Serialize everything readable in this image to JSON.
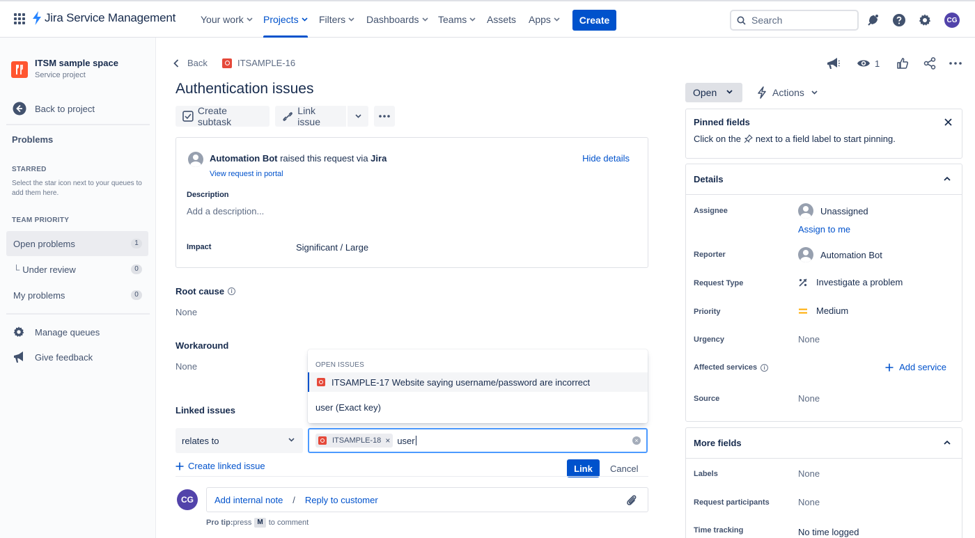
{
  "colors": {
    "brand": "#0052cc",
    "issue_type": "#e5493a",
    "project_icon": "#ff5630",
    "avatar": "#5243aa",
    "priority_medium": "#ffab00"
  },
  "topnav": {
    "logo_text": "Jira Service Management",
    "items": [
      {
        "label": "Your work",
        "has_chevron": true
      },
      {
        "label": "Projects",
        "has_chevron": true,
        "active": true
      },
      {
        "label": "Filters",
        "has_chevron": true
      },
      {
        "label": "Dashboards",
        "has_chevron": true
      },
      {
        "label": "Teams",
        "has_chevron": true
      },
      {
        "label": "Assets",
        "has_chevron": false
      },
      {
        "label": "Apps",
        "has_chevron": true
      }
    ],
    "create_label": "Create",
    "search_placeholder": "Search",
    "avatar_initials": "CG"
  },
  "sidebar": {
    "project_name": "ITSM sample space",
    "project_type": "Service project",
    "back_label": "Back to project",
    "section": "Problems",
    "starred_heading": "STARRED",
    "starred_note": "Select the star icon next to your queues to add them here.",
    "team_priority_heading": "TEAM PRIORITY",
    "queues": [
      {
        "label": "Open problems",
        "count": "1",
        "selected": true
      },
      {
        "label": "Under review",
        "count": "0",
        "prefix": "└"
      },
      {
        "label": "My problems",
        "count": "0"
      }
    ],
    "manage_queues": "Manage queues",
    "give_feedback": "Give feedback"
  },
  "issue": {
    "back_label": "Back",
    "key": "ITSAMPLE-16",
    "title": "Authentication issues",
    "toolbar": {
      "create_subtask": "Create subtask",
      "link_issue": "Link issue"
    },
    "request": {
      "reporter_name": "Automation Bot",
      "raised_text": " raised this request via ",
      "channel": "Jira",
      "view_portal": "View request in portal",
      "hide_details": "Hide details",
      "description_label": "Description",
      "description_placeholder": "Add a description...",
      "impact_label": "Impact",
      "impact_value": "Significant / Large"
    },
    "root_cause_label": "Root cause",
    "root_cause_value": "None",
    "workaround_label": "Workaround",
    "workaround_value": "None",
    "linked_issues_label": "Linked issues",
    "link_form": {
      "relation": "relates to",
      "chip_key": "ITSAMPLE-18",
      "chip_remove": "×",
      "typed_text": "user",
      "link_label": "Link",
      "cancel_label": "Cancel",
      "create_linked": "Create linked issue"
    },
    "dropdown": {
      "heading": "OPEN ISSUES",
      "item1": "ITSAMPLE-17 Website saying username/password are incorrect",
      "item2": "user (Exact key)"
    },
    "comment": {
      "avatar_initials": "CG",
      "internal_note": "Add internal note",
      "slash": "/",
      "reply": "Reply to customer",
      "protip_bold": "Pro tip:",
      "protip_press": " press ",
      "protip_key": "M",
      "protip_rest": " to comment"
    }
  },
  "right": {
    "watch_count": "1",
    "status": "Open",
    "actions_label": "Actions",
    "pinned": {
      "title": "Pinned fields",
      "text_before": "Click on the ",
      "text_after": " next to a field label to start pinning."
    },
    "details": {
      "title": "Details",
      "assignee_label": "Assignee",
      "assignee_value": "Unassigned",
      "assign_to_me": "Assign to me",
      "reporter_label": "Reporter",
      "reporter_value": "Automation Bot",
      "request_type_label": "Request Type",
      "request_type_value": "Investigate a problem",
      "priority_label": "Priority",
      "priority_value": "Medium",
      "urgency_label": "Urgency",
      "urgency_value": "None",
      "affected_label": "Affected services",
      "add_service": "Add service",
      "source_label": "Source",
      "source_value": "None"
    },
    "more_fields": {
      "title": "More fields",
      "labels_label": "Labels",
      "labels_value": "None",
      "participants_label": "Request participants",
      "participants_value": "None",
      "time_label": "Time tracking",
      "time_value": "No time logged"
    }
  }
}
